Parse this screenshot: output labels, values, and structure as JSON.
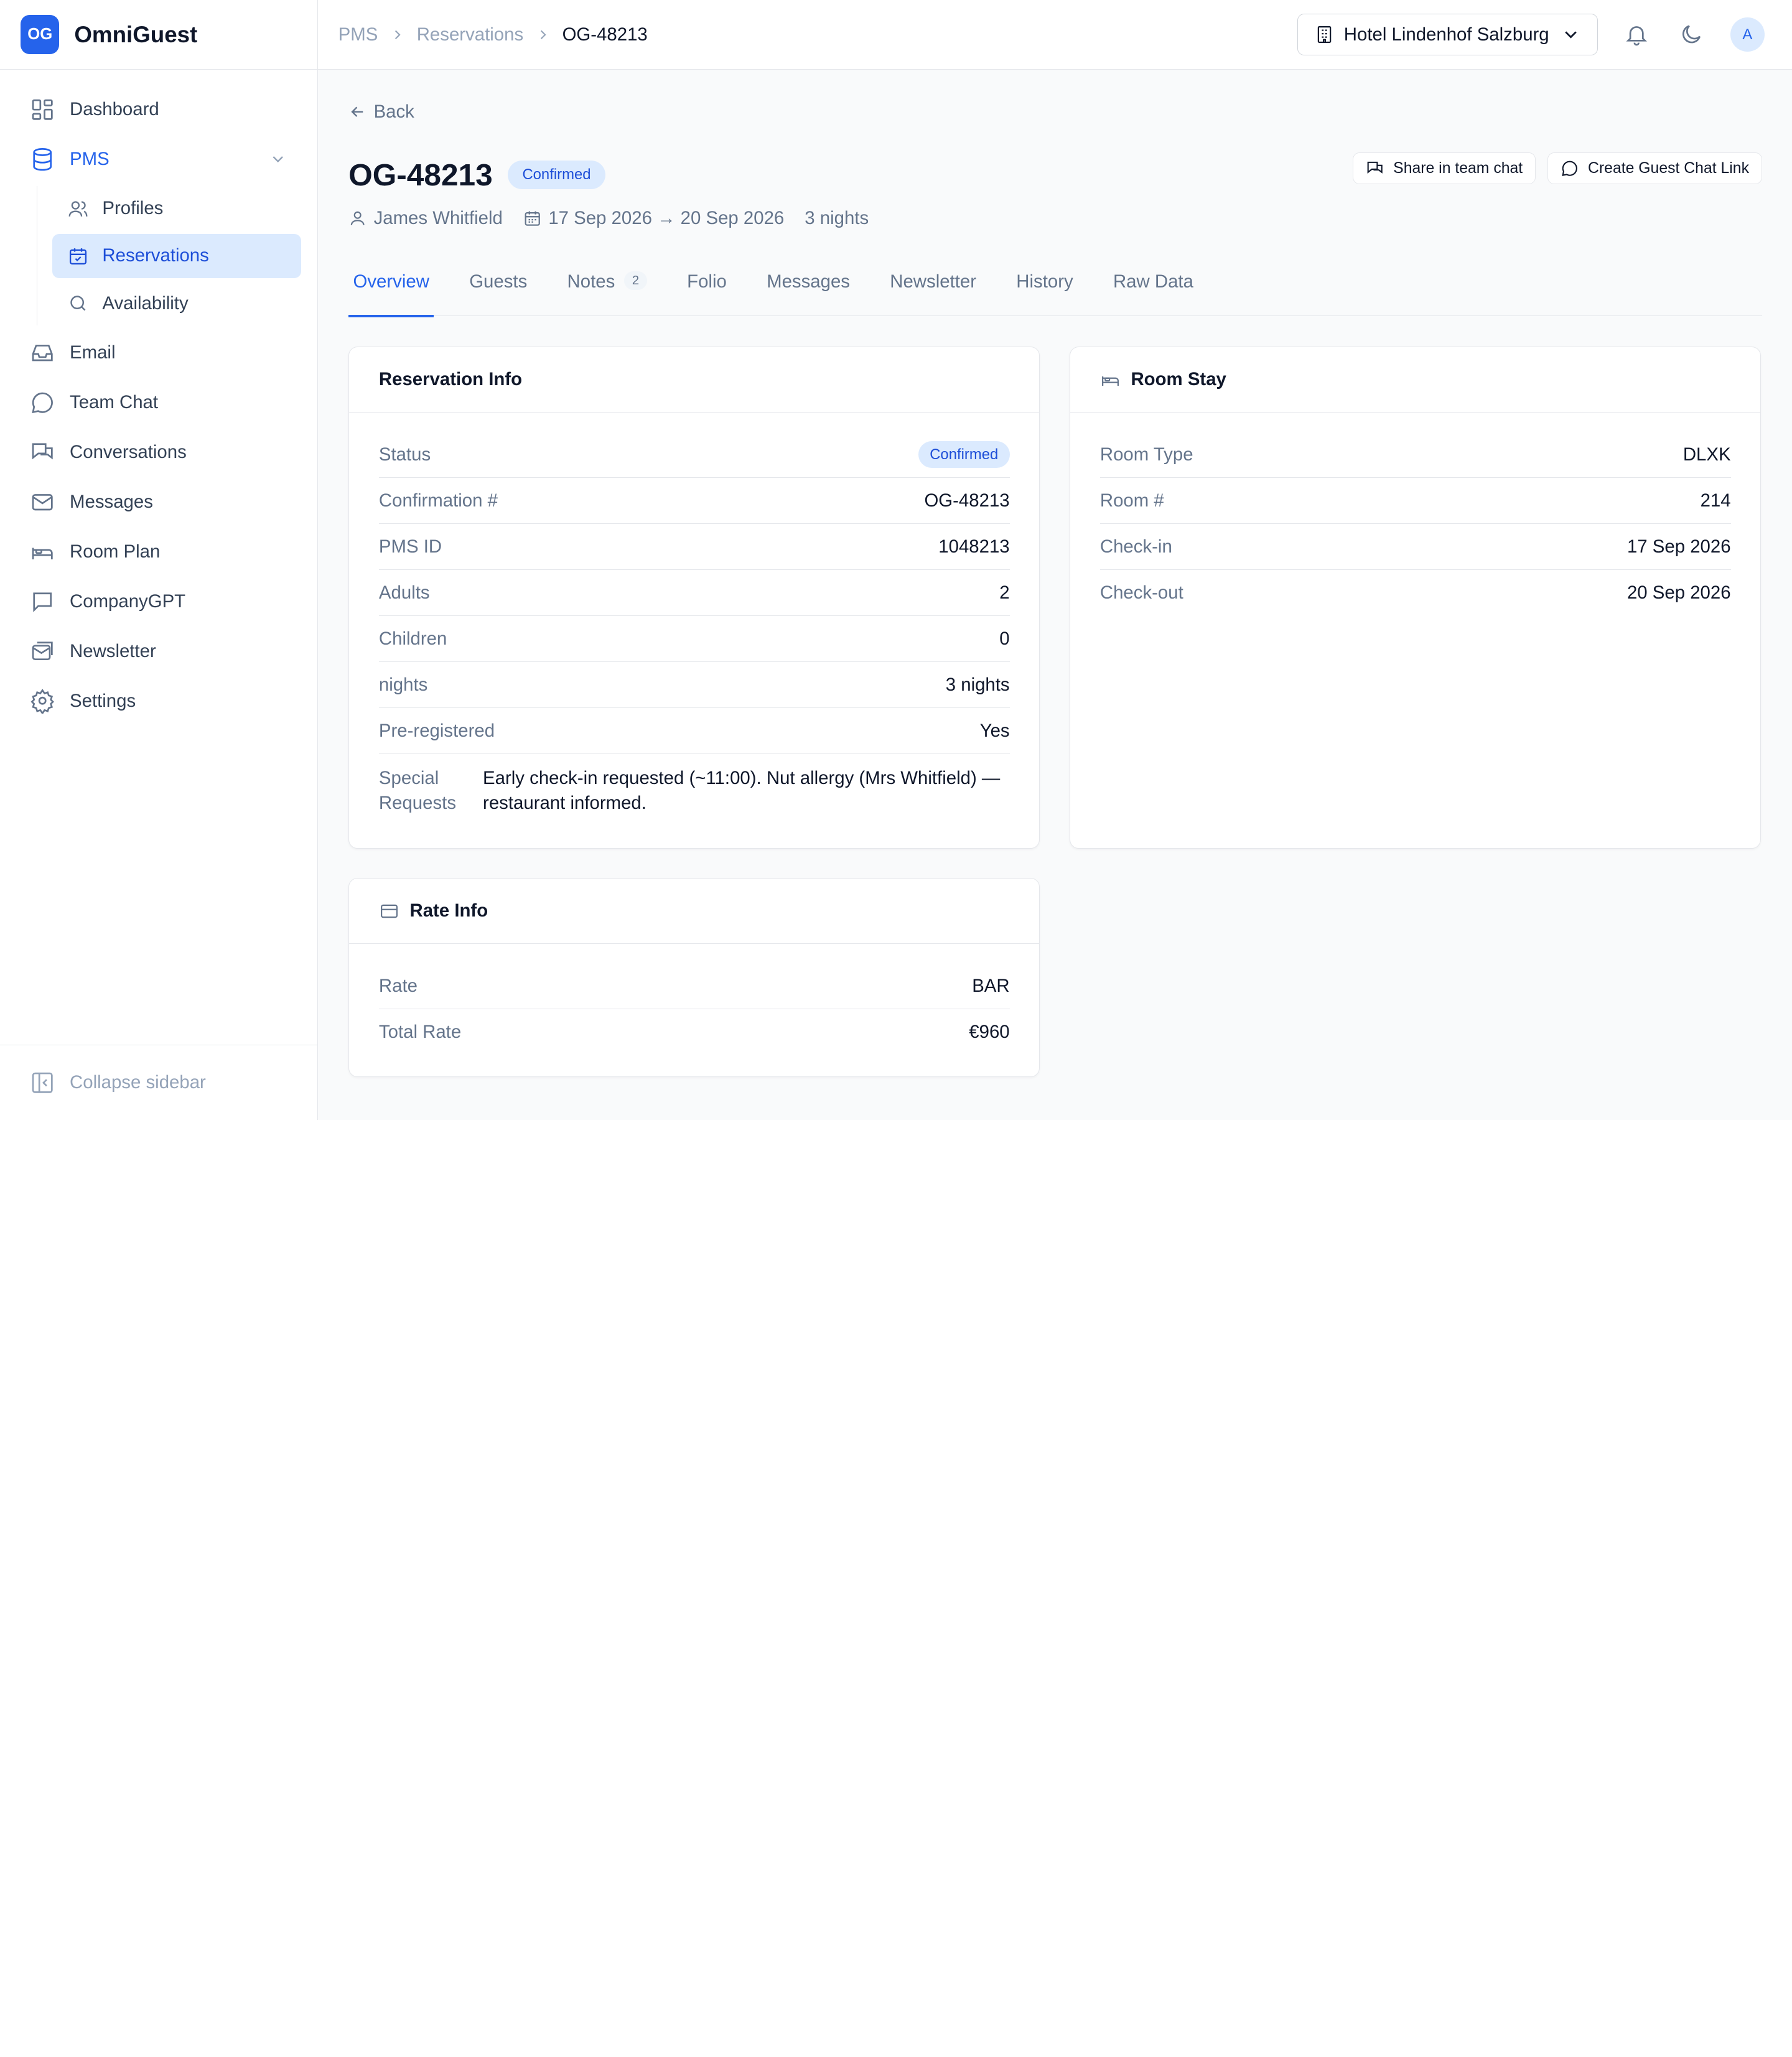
{
  "brand": {
    "logo": "OG",
    "name": "OmniGuest",
    "color": "#2563eb"
  },
  "sidebar": {
    "items": [
      {
        "label": "Dashboard",
        "icon": "dashboard-icon"
      },
      {
        "label": "PMS",
        "icon": "database-icon"
      },
      {
        "label": "Email",
        "icon": "inbox-icon"
      },
      {
        "label": "Team Chat",
        "icon": "chat-bubble-icon"
      },
      {
        "label": "Conversations",
        "icon": "conversations-icon"
      },
      {
        "label": "Messages",
        "icon": "mail-icon"
      },
      {
        "label": "Room Plan",
        "icon": "bed-icon"
      },
      {
        "label": "CompanyGPT",
        "icon": "message-square-icon"
      },
      {
        "label": "Newsletter",
        "icon": "newsletter-icon"
      },
      {
        "label": "Settings",
        "icon": "gear-icon"
      }
    ],
    "pms_sub": [
      {
        "label": "Profiles",
        "icon": "users-icon"
      },
      {
        "label": "Reservations",
        "icon": "calendar-check-icon"
      },
      {
        "label": "Availability",
        "icon": "search-icon"
      }
    ],
    "collapse_label": "Collapse sidebar"
  },
  "topbar": {
    "breadcrumb": [
      "PMS",
      "Reservations",
      "OG-48213"
    ],
    "hotel": "Hotel Lindenhof Salzburg",
    "avatar": "A"
  },
  "page": {
    "back_label": "Back",
    "title": "OG-48213",
    "status_badge": "Confirmed",
    "guest_name": "James Whitfield",
    "dates": "17 Sep 2026 → 20 Sep 2026",
    "nights": "3 nights",
    "share_button": "Share in team chat",
    "guest_link_button": "Create Guest Chat Link"
  },
  "tabs": [
    {
      "label": "Overview"
    },
    {
      "label": "Guests"
    },
    {
      "label": "Notes",
      "count": "2"
    },
    {
      "label": "Folio"
    },
    {
      "label": "Messages"
    },
    {
      "label": "Newsletter"
    },
    {
      "label": "History"
    },
    {
      "label": "Raw Data"
    }
  ],
  "reservation_info": {
    "title": "Reservation Info",
    "rows": [
      {
        "k": "Status",
        "v": "Confirmed"
      },
      {
        "k": "Confirmation #",
        "v": "OG-48213"
      },
      {
        "k": "PMS ID",
        "v": "1048213"
      },
      {
        "k": "Adults",
        "v": "2"
      },
      {
        "k": "Children",
        "v": "0"
      },
      {
        "k": "nights",
        "v": "3 nights"
      },
      {
        "k": "Pre-registered",
        "v": "Yes"
      },
      {
        "k": "Special Requests",
        "v": "Early check-in requested (~11:00). Nut allergy (Mrs Whitfield) — restaurant informed."
      }
    ]
  },
  "room_stay": {
    "title": "Room Stay",
    "rows": [
      {
        "k": "Room Type",
        "v": "DLXK"
      },
      {
        "k": "Room #",
        "v": "214"
      },
      {
        "k": "Check-in",
        "v": "17 Sep 2026"
      },
      {
        "k": "Check-out",
        "v": "20 Sep 2026"
      }
    ]
  },
  "rate_info": {
    "title": "Rate Info",
    "rows": [
      {
        "k": "Rate",
        "v": "BAR"
      },
      {
        "k": "Total Rate",
        "v": "€960"
      }
    ]
  }
}
